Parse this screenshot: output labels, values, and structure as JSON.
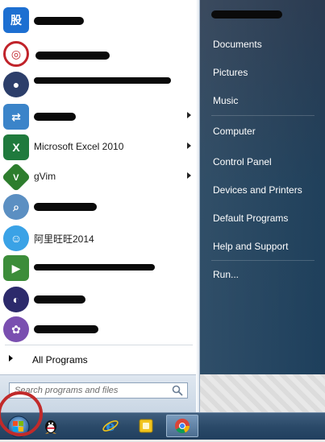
{
  "programs": [
    {
      "label": "",
      "icon": "app-icon-blue-chinese-char",
      "color": "#1d6fd1",
      "glyph": "股",
      "has_submenu": false
    },
    {
      "label": "",
      "icon": "app-icon-red-circle-logo",
      "color": "#c0232a",
      "glyph": "◎",
      "has_submenu": false
    },
    {
      "label": "",
      "icon": "app-icon-dark-figure",
      "color": "#2c3e6a",
      "glyph": "●",
      "has_submenu": false
    },
    {
      "label": "",
      "icon": "app-icon-remote-desktop",
      "color": "#3b84c9",
      "glyph": "⇄",
      "has_submenu": true
    },
    {
      "label": "Microsoft Excel 2010",
      "icon": "excel-icon",
      "color": "#1f7a3d",
      "glyph": "X",
      "has_submenu": true
    },
    {
      "label": "gVim",
      "icon": "gvim-icon",
      "color": "#2d7d2d",
      "glyph": "V",
      "has_submenu": true
    },
    {
      "label": "",
      "icon": "app-icon-magnifier",
      "color": "#5b8fc2",
      "glyph": "⌕",
      "has_submenu": false
    },
    {
      "label": "阿里旺旺2014",
      "icon": "aliwangwang-icon",
      "color": "#3aa2e6",
      "glyph": "☺",
      "has_submenu": false
    },
    {
      "label": "",
      "icon": "app-icon-media-play",
      "color": "#3c8d3a",
      "glyph": "▶",
      "has_submenu": false
    },
    {
      "label": "",
      "icon": "eclipse-icon",
      "color": "#2c2a6b",
      "glyph": "◐",
      "has_submenu": false
    },
    {
      "label": "",
      "icon": "app-icon-purple-molecule",
      "color": "#7a4fb0",
      "glyph": "✿",
      "has_submenu": false
    }
  ],
  "all_programs_label": "All Programs",
  "search": {
    "placeholder": "Search programs and files"
  },
  "right_pane": {
    "user_name": "",
    "items": [
      {
        "label": "Documents"
      },
      {
        "label": "Pictures"
      },
      {
        "label": "Music"
      },
      {
        "label": "Computer"
      },
      {
        "label": "Control Panel"
      },
      {
        "label": "Devices and Printers"
      },
      {
        "label": "Default Programs"
      },
      {
        "label": "Help and Support"
      },
      {
        "label": "Run..."
      }
    ]
  },
  "taskbar": {
    "start_button": "windows-start-orb",
    "pinned": [
      {
        "icon": "qq-penguin-icon"
      },
      {
        "icon": "internet-explorer-icon"
      },
      {
        "icon": "yellow-app-icon"
      },
      {
        "icon": "chrome-icon",
        "active": true
      }
    ]
  },
  "colors": {
    "highlight_ring": "#c12a2a",
    "right_pane": "#20405b",
    "taskbar": "#2b4a69"
  }
}
